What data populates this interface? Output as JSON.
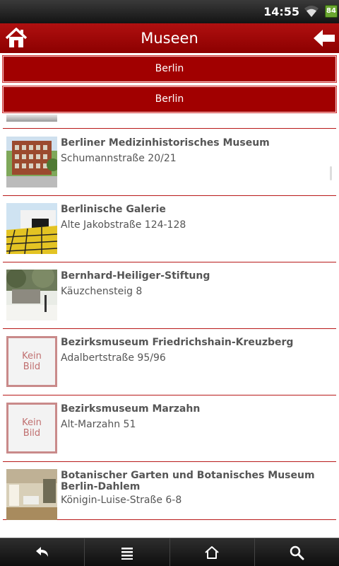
{
  "status": {
    "time": "14:55",
    "battery": "84"
  },
  "header": {
    "title": "Museen"
  },
  "filters": [
    "Berlin",
    "Berlin"
  ],
  "museums": [
    {
      "name": "Berliner Medizinhistorisches Museum",
      "address": "Schumannstraße 20/21",
      "image": "photo-building-red"
    },
    {
      "name": "Berlinische Galerie",
      "address": "Alte Jakobstraße 124-128",
      "image": "photo-gallery-yellow"
    },
    {
      "name": "Bernhard-Heiliger-Stiftung",
      "address": "Käuzchensteig 8",
      "image": "photo-garden"
    },
    {
      "name": "Bezirksmuseum Friedrichshain-Kreuzberg",
      "address": "Adalbertstraße 95/96",
      "placeholder": "Kein Bild"
    },
    {
      "name": "Bezirksmuseum Marzahn",
      "address": "Alt-Marzahn 51",
      "placeholder": "Kein Bild"
    },
    {
      "name": "Botanischer Garten und Botanisches Museum Berlin-Dahlem",
      "address": "Königin-Luise-Straße 6-8",
      "image": "photo-museum-interior"
    }
  ],
  "bottom_nav": [
    "back-icon",
    "menu-icon",
    "home-icon",
    "search-icon"
  ],
  "colors": {
    "accent": "#a10000",
    "divider": "#b81a1a",
    "text": "#555555"
  }
}
